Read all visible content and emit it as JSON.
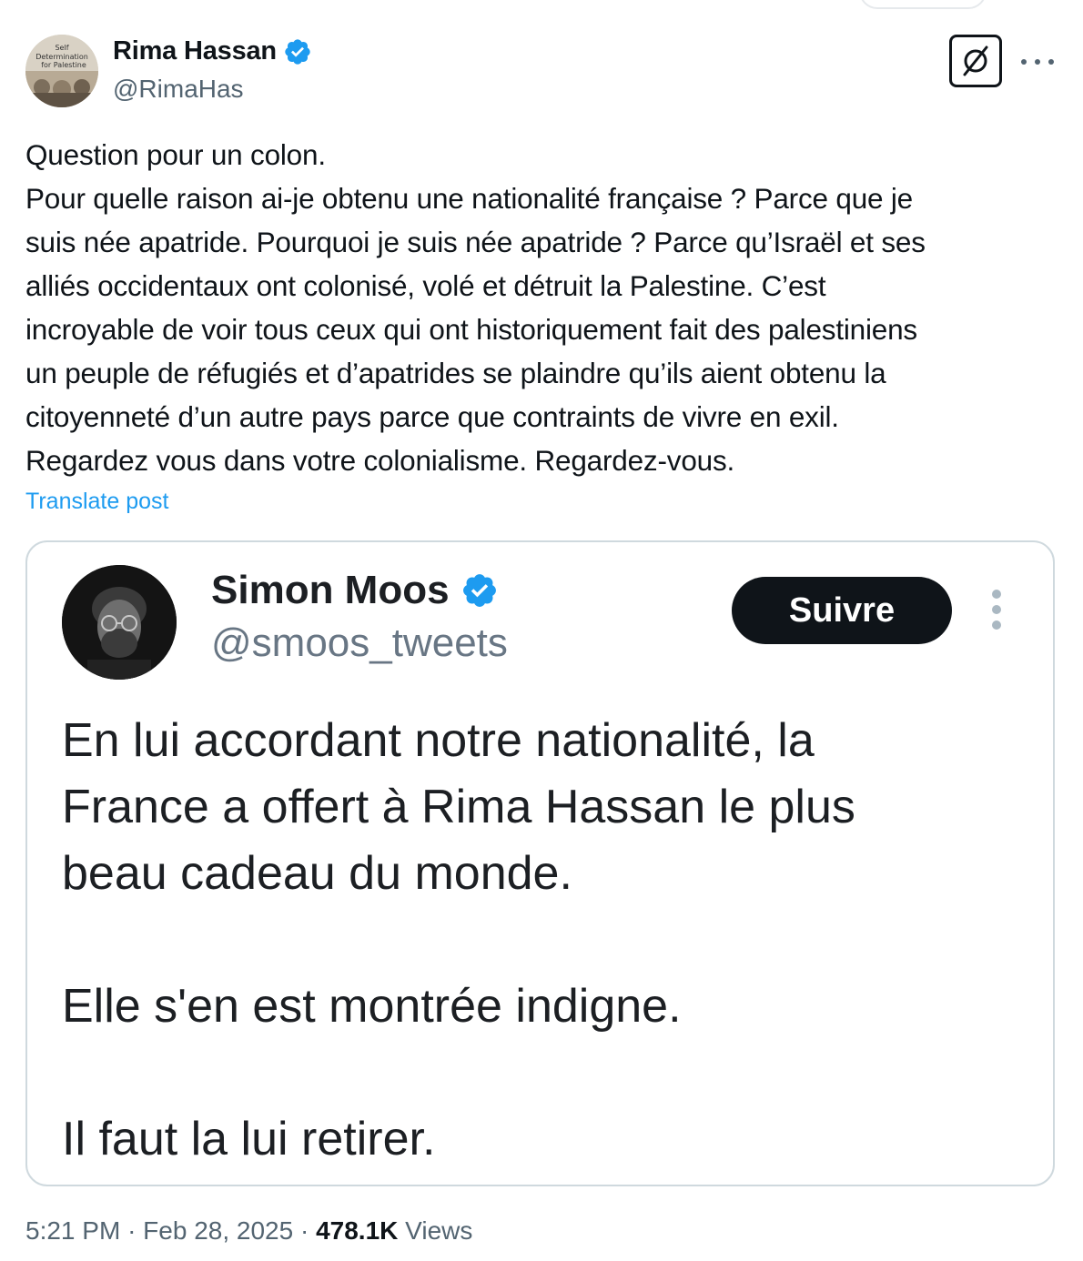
{
  "author": {
    "name": "Rima Hassan",
    "handle": "@RimaHas",
    "avatar_lines": [
      "Self",
      "Determination",
      "for Palestine"
    ]
  },
  "tweet": {
    "lines": [
      "Question pour un colon.",
      "Pour quelle raison ai-je obtenu une nationalité française ? Parce que je",
      "suis née apatride. Pourquoi je suis née apatride ? Parce qu’Israël et ses",
      "alliés occidentaux ont colonisé, volé et détruit la Palestine. C’est",
      "incroyable de voir tous ceux qui ont historiquement fait des palestiniens",
      "un peuple de réfugiés et d’apatrides se plaindre qu’ils aient obtenu la",
      "citoyenneté d’un autre pays parce que contraints de vivre en exil.",
      "Regardez vous dans votre colonialisme. Regardez-vous."
    ],
    "translate_label": "Translate post"
  },
  "quoted": {
    "name": "Simon Moos",
    "handle": "@smoos_tweets",
    "follow_label": "Suivre",
    "lines": [
      "En lui accordant notre nationalité, la",
      "France a offert à Rima Hassan le plus",
      "beau cadeau du monde.",
      "Elle s'en est montrée indigne.",
      "Il faut la lui retirer."
    ]
  },
  "meta": {
    "time": "5:21 PM",
    "separator": "·",
    "date": "Feb 28, 2025",
    "views_count": "478.1K",
    "views_label": "Views"
  },
  "icons": {
    "verified": "verified-badge-icon",
    "grok": "grok-icon",
    "more": "more-horizontal-icon",
    "quote_more": "more-vertical-icon"
  },
  "colors": {
    "text": "#0f1419",
    "secondary": "#536471",
    "link": "#1d9bf0",
    "verified": "#1d9bf0",
    "border": "#cfd9de",
    "button_bg": "#0f1419"
  }
}
